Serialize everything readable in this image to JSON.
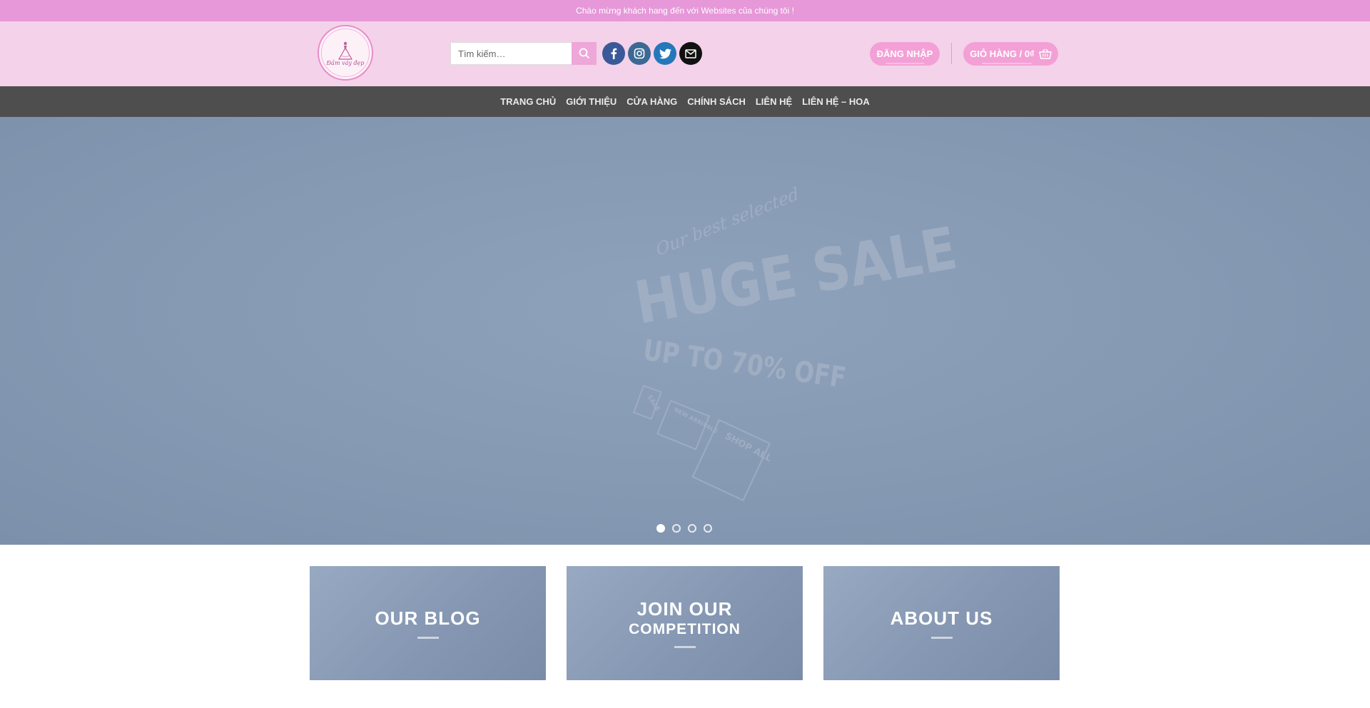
{
  "topbar": {
    "welcome_text": "Chào mừng khách hang đến với Websites của chúng tôi !"
  },
  "header": {
    "logo_text": "Đầm váy đẹp",
    "search": {
      "placeholder": "Tìm kiếm…",
      "value": ""
    },
    "socials": [
      "facebook-icon",
      "instagram-icon",
      "twitter-icon",
      "email-icon"
    ],
    "login_label": "ĐĂNG NHẬP",
    "cart_label": "GIỎ HÀNG / 0₫"
  },
  "nav": {
    "items": [
      {
        "label": "TRANG CHỦ"
      },
      {
        "label": "GIỚI THIỆU"
      },
      {
        "label": "CỬA HÀNG"
      },
      {
        "label": "CHÍNH SÁCH"
      },
      {
        "label": "LIÊN HỆ"
      },
      {
        "label": "LIÊN HỆ – HOA"
      }
    ]
  },
  "hero": {
    "script_text": "Our best selected",
    "headline": "HUGE SALE",
    "subline": "UP TO 70% OFF",
    "tags": [
      "SALE",
      "NEW ARRIVALS",
      "SHOP ALL"
    ],
    "slides_total": 4,
    "active_slide": 1
  },
  "boxes": [
    {
      "title": "OUR BLOG",
      "subtitle": ""
    },
    {
      "title": "JOIN OUR",
      "subtitle": "COMPETITION"
    },
    {
      "title": "ABOUT US",
      "subtitle": ""
    }
  ],
  "colors": {
    "topbar": "#e698d8",
    "header": "#f3d2ea",
    "accent_pink": "#f3a0d6",
    "nav": "#4e4e4e",
    "hero": "#8599b3"
  }
}
